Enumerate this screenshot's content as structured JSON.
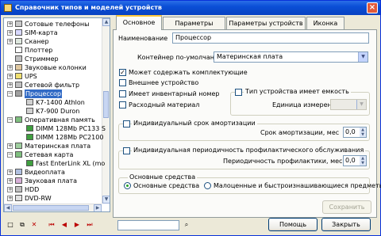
{
  "window": {
    "title": "Справочник типов и моделей устройств",
    "close": "×"
  },
  "tree": {
    "items": [
      {
        "label": "Сотовые телефоны",
        "expander": "+"
      },
      {
        "label": "SIM-карта",
        "expander": "+"
      },
      {
        "label": "Сканер",
        "expander": "+"
      },
      {
        "label": "Плоттер",
        "expander": ""
      },
      {
        "label": "Стриммер",
        "expander": ""
      },
      {
        "label": "Звуковые колонки",
        "expander": "+"
      },
      {
        "label": "UPS",
        "expander": "+"
      },
      {
        "label": "Сетевой фильтр",
        "expander": "+"
      },
      {
        "label": "Процессор",
        "expander": "−"
      },
      {
        "label": "K7-1400 Athlon",
        "expander": ""
      },
      {
        "label": "K7-900 Duron",
        "expander": ""
      },
      {
        "label": "Оперативная память",
        "expander": "−"
      },
      {
        "label": "DIMM 128Mb PC133 S",
        "expander": ""
      },
      {
        "label": "DIMM 128Mb PC2100",
        "expander": ""
      },
      {
        "label": "Материнская плата",
        "expander": "+"
      },
      {
        "label": "Сетевая карта",
        "expander": "−"
      },
      {
        "label": "Fast EnterLink XL (mo",
        "expander": ""
      },
      {
        "label": "Видеоплата",
        "expander": "+"
      },
      {
        "label": "Звуковая плата",
        "expander": "+"
      },
      {
        "label": "HDD",
        "expander": "+"
      },
      {
        "label": "DVD-RW",
        "expander": "+"
      }
    ]
  },
  "tabs": [
    "Основное",
    "Параметры модели",
    "Параметры устройств",
    "Иконка"
  ],
  "form": {
    "name_label": "Наименование",
    "name_value": "Процессор",
    "container_label": "Контейнер по-умолчанию",
    "container_value": "Материнская плата",
    "can_contain_label": "Может содержать комплектующие",
    "can_contain_checked": "✓",
    "external_label": "Внешнее устройство",
    "inventory_label": "Имеет инвентарный номер",
    "consumable_label": "Расходный материал",
    "capacity_group_label": "Тип устройства имеет емкость",
    "unit_label": "Единица измерения",
    "amort_group_label": "Индивидуальный срок амортизации",
    "amort_period_label": "Срок амортизации, мес",
    "amort_value": "0,0",
    "maint_group_label": "Индивидуальная периодичность профилактического обслуживания",
    "maint_period_label": "Периодичность профилактики, мес",
    "maint_value": "0,0",
    "assets_group_label": "Основные средства",
    "radio_fixed_label": "Основные средства",
    "radio_low_label": "Малоценные и быстроизнашивающиеся предметы",
    "save_button": "Сохранить"
  },
  "footer": {
    "help_button": "Помощь",
    "close_button": "Закрыть",
    "toolbar_icons": [
      "new-icon",
      "copy-icon",
      "delete-icon",
      "first-icon",
      "prev-icon",
      "next-icon",
      "last-icon"
    ],
    "toolbar_glyphs": [
      "□",
      "⧉",
      "✕",
      "⏮",
      "◀",
      "▶",
      "⏭"
    ],
    "search_icon_glyph": "⌕"
  }
}
